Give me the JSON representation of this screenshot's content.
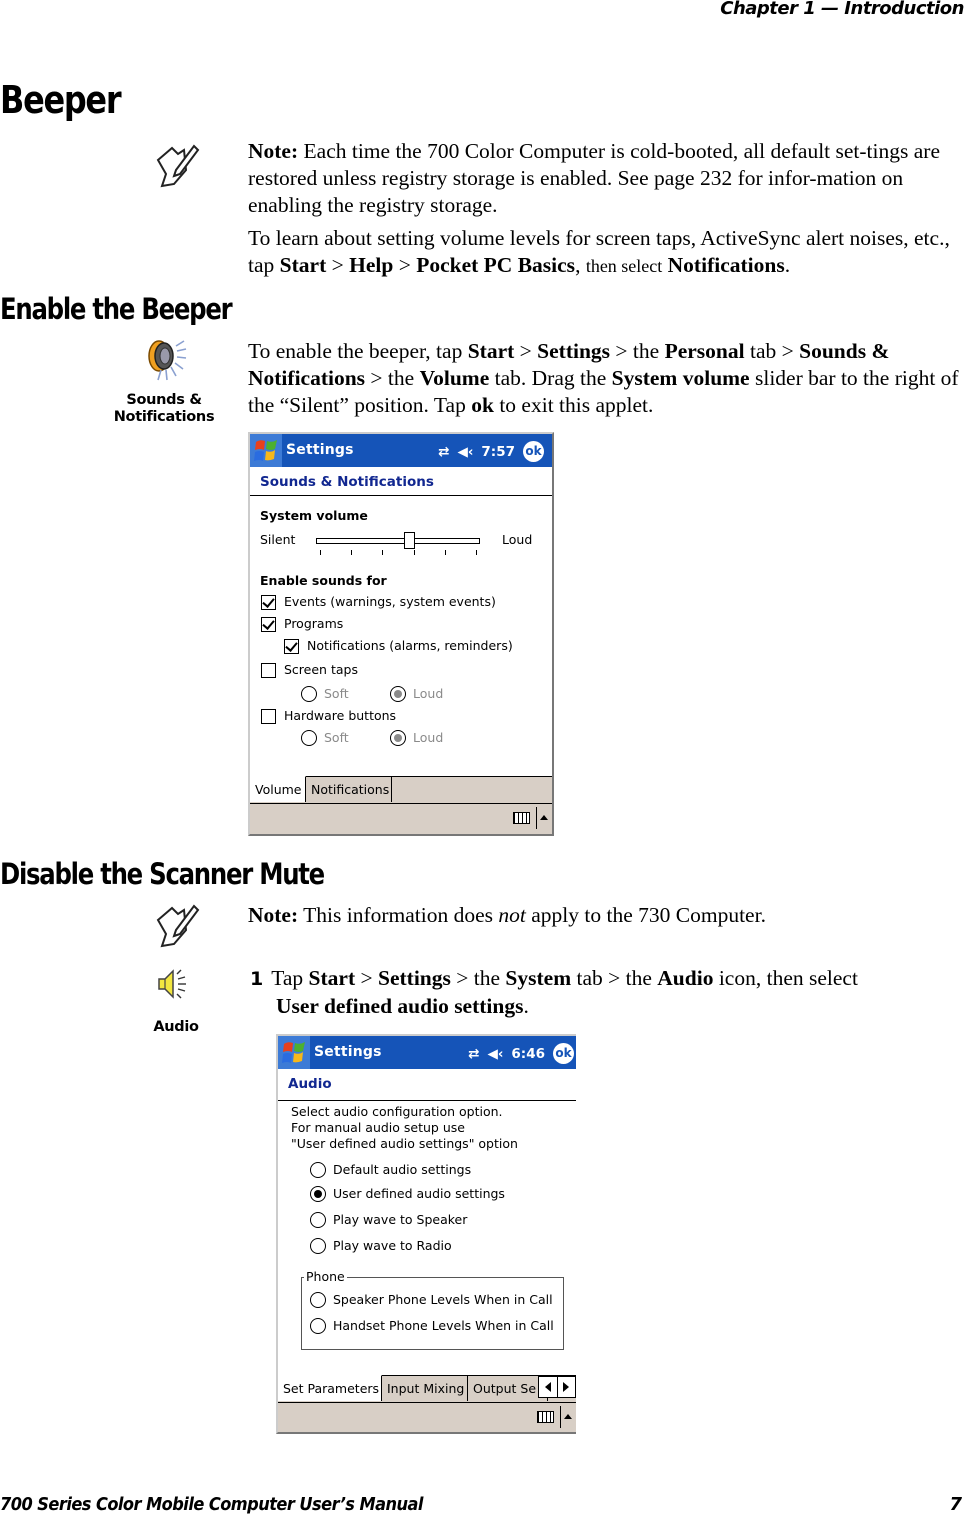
{
  "header": {
    "chapter": "Chapter  1  —  Introduction"
  },
  "sections": {
    "beeper": {
      "title": "Beeper",
      "note": {
        "label": "Note:",
        "text": " Each time the 700 Color Computer is cold-booted, all default set-tings are restored unless registry storage is enabled. See page 232 for infor-mation on enabling the registry storage."
      },
      "para": {
        "t1": "To learn about setting volume levels for screen taps, ActiveSync alert noises, etc., tap ",
        "b1": "Start",
        "sep": " > ",
        "b2": "Help",
        "b3": "Pocket PC Basics",
        "t2": ", ",
        "small": "then select",
        "t3": " ",
        "b4": "Notifications",
        "t4": "."
      }
    },
    "enable_beeper": {
      "title": "Enable the Beeper",
      "icon_label_1": "Sounds &",
      "icon_label_2": "Notifications",
      "para": {
        "t1": "To enable the beeper, tap ",
        "b1": "Start",
        "sep": " > ",
        "b2": "Settings",
        "t2": " > the ",
        "b3": "Personal",
        "t3": " tab > ",
        "b4": "Sounds & Notifications",
        "t4": " > the ",
        "b5": "Volume",
        "t5": " tab. Drag the ",
        "b6": "System volume",
        "t6": " slider bar to the right of the “Silent” position. Tap ",
        "b7": "ok",
        "t7": " to exit this applet."
      },
      "screen": {
        "title": "Settings",
        "time": "7:57",
        "ok": "ok",
        "app_title": "Sounds & Notifications",
        "system_volume_label": "System volume",
        "silent": "Silent",
        "loud": "Loud",
        "volume_level_fraction": 0.5,
        "enable_sounds_for": "Enable sounds for",
        "checkboxes": [
          {
            "label": "Events (warnings, system events)",
            "checked": true
          },
          {
            "label": "Programs",
            "checked": true
          },
          {
            "label": "Notifications (alarms, reminders)",
            "checked": true
          },
          {
            "label": "Screen taps",
            "checked": false
          },
          {
            "label": "Hardware buttons",
            "checked": false
          }
        ],
        "radio_soft": "Soft",
        "radio_loud": "Loud",
        "tabs": [
          {
            "label": "Volume",
            "active": true
          },
          {
            "label": "Notifications",
            "active": false
          }
        ]
      }
    },
    "scanner_mute": {
      "title": "Disable the Scanner Mute",
      "note": {
        "label": "Note:",
        "t1": " This information does ",
        "em": "not",
        "t2": " apply to the 730 Computer."
      },
      "icon_label": "Audio",
      "step": {
        "num": "1",
        "t1": "Tap ",
        "b1": "Start",
        "sep": " > ",
        "b2": "Settings",
        "t2": " > the ",
        "b3": "System",
        "t3": " tab > the ",
        "b4": "Audio",
        "t4": " icon, then select ",
        "b5": "User defined audio settings",
        "t5": "."
      },
      "screen": {
        "title": "Settings",
        "time": "6:46",
        "ok": "ok",
        "app_title": "Audio",
        "desc": [
          "Select audio configuration option.",
          "For manual audio setup use",
          "\"User defined audio settings\" option"
        ],
        "options": [
          {
            "label": "Default audio settings",
            "selected": false
          },
          {
            "label": "User defined audio settings",
            "selected": true
          },
          {
            "label": "Play wave to Speaker",
            "selected": false
          },
          {
            "label": "Play wave to Radio",
            "selected": false
          }
        ],
        "phone_group": "Phone",
        "phone_options": [
          "Speaker Phone Levels When in Call",
          "Handset Phone Levels When in Call"
        ],
        "tabs": [
          {
            "label": "Set Parameters",
            "active": true
          },
          {
            "label": "Input Mixing",
            "active": false
          },
          {
            "label": "Output Se",
            "active": false
          }
        ]
      }
    }
  },
  "footer": {
    "title": "700 Series Color Mobile Computer User’s Manual",
    "page": "7"
  }
}
